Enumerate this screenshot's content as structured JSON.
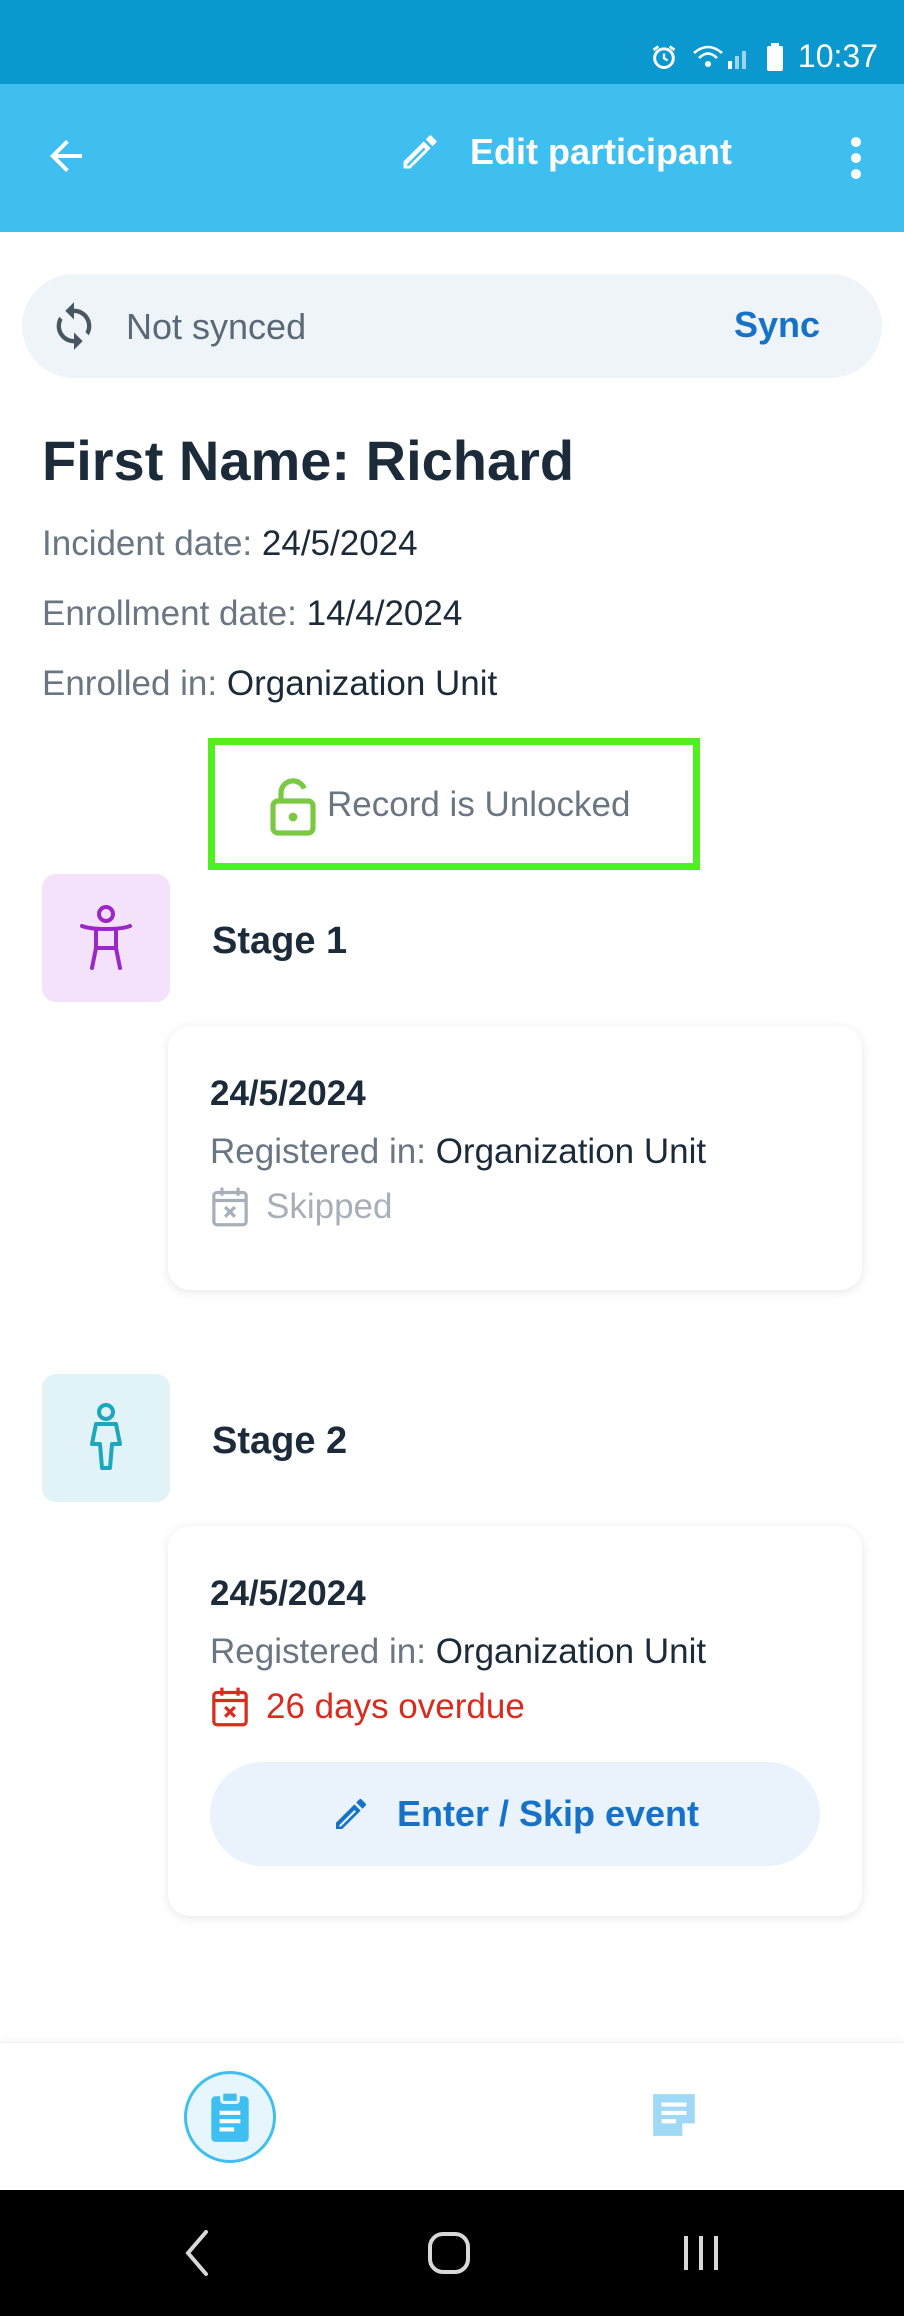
{
  "status_bar": {
    "time": "10:37"
  },
  "app_bar": {
    "title": "Edit participant"
  },
  "sync": {
    "status": "Not synced",
    "action": "Sync"
  },
  "participant": {
    "name_line": "First Name: Richard",
    "incident_label": "Incident date:",
    "incident_value": "24/5/2024",
    "enrollment_label": "Enrollment date:",
    "enrollment_value": "14/4/2024",
    "enrolled_label": "Enrolled in:",
    "enrolled_value": "Organization Unit"
  },
  "lock": {
    "text": "Record is Unlocked"
  },
  "stages": [
    {
      "title": "Stage 1",
      "date": "24/5/2024",
      "registered_label": "Registered in:",
      "registered_value": "Organization Unit",
      "status": "Skipped"
    },
    {
      "title": "Stage 2",
      "date": "24/5/2024",
      "registered_label": "Registered in:",
      "registered_value": "Organization Unit",
      "status": "26 days overdue",
      "action": "Enter / Skip event"
    }
  ],
  "colors": {
    "app_bar": "#3fbef0",
    "status_bar": "#0a98cf",
    "accent": "#1672c8",
    "overdue": "#d92b1e",
    "unlocked": "#7ac943",
    "highlight": "#50f020"
  },
  "icons": {
    "back": "arrow-left-icon",
    "edit": "pencil-icon",
    "more": "more-vertical-icon",
    "sync": "sync-icon",
    "lock": "lock-open-icon",
    "stage1": "child-figure-icon",
    "stage2": "person-figure-icon",
    "skipped": "calendar-x-icon",
    "overdue": "calendar-x-icon",
    "nav_details": "clipboard-icon",
    "nav_notes": "notes-icon"
  }
}
